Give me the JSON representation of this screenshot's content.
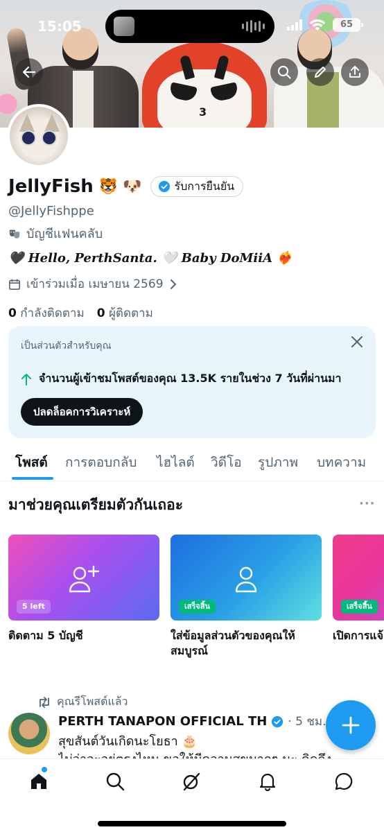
{
  "status_bar": {
    "time": "15:05",
    "battery": "65"
  },
  "profile": {
    "name": "JellyFish",
    "name_emojis": "🐯 🐶",
    "verify_label": "รับการยืนยัน",
    "handle": "@JellyFishppe",
    "account_type": "บัญชีแฟนคลับ",
    "bio": "🖤 Hello, PerthSanta. 🤍 Baby DoMiiA ❤️‍🔥",
    "joined": "เข้าร่วมเมื่อ เมษายน 2569",
    "following_count": "0",
    "following_label": "กำลังติดตาม",
    "followers_count": "0",
    "followers_label": "ผู้ติดตาม"
  },
  "personal_card": {
    "label": "เป็นส่วนตัวสำหรับคุณ",
    "stat": "จำนวนผู้เข้าชมโพสต์ของคุณ 13.5K รายในช่วง 7 วันที่ผ่านมา",
    "button": "ปลดล็อคการวิเคราะห์"
  },
  "tabs": [
    "โพสต์",
    "การตอบกลับ",
    "ไฮไลต์",
    "วิดีโอ",
    "รูปภาพ",
    "บทความ"
  ],
  "get_started": {
    "title": "มาช่วยคุณเตรียมตัวกันเถอะ",
    "more": "···",
    "tiles": [
      {
        "badge": "5 left",
        "caption": "ติดตาม 5 บัญชี",
        "icon": "add-user-icon"
      },
      {
        "badge": "เสร็จสิ้น",
        "caption_line1": "ใส่ข้อมูลส่วนตัวของคุณให้",
        "caption_line2": "สมบูรณ์",
        "icon": "user-icon"
      },
      {
        "badge": "เสร็จสิ้น",
        "caption": "เปิดการแจ้ง",
        "icon": "bell-icon"
      }
    ]
  },
  "tweet": {
    "repost_label": "คุณรีโพสต์แล้ว",
    "author": "PERTH TANAPON OFFICIAL TH",
    "time": "· 5 ชม.",
    "text": "สุขสันต์วันเกิดนะโยธา 🎂",
    "text2": "ไม่ว่าจะอยู่ตรงไหน ขอให้มีความสุขมากๆ นะ คิดถึง"
  },
  "colors": {
    "accent": "#1d9bf0",
    "verified": "#1d9bf0",
    "card_bg": "#e9f5fd",
    "done_badge": "#00ba7c"
  }
}
